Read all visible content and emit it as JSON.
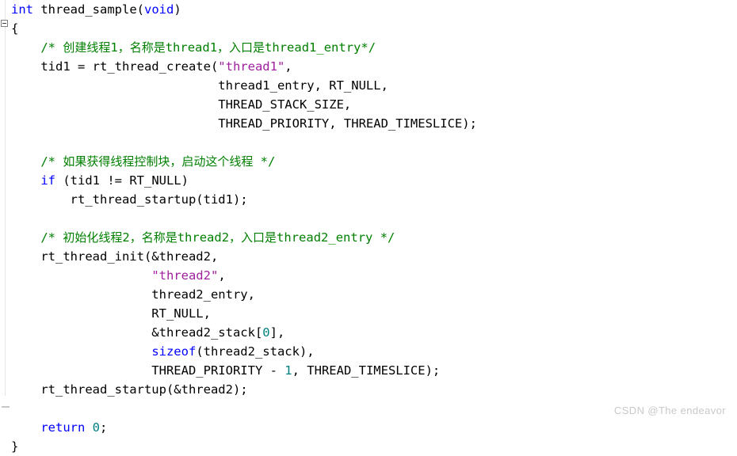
{
  "editor": {
    "background_color": "#ffffff",
    "gutter": {
      "fold_toggle_label": "-",
      "fold_toggle_name": "collapse-block-toggle"
    },
    "syntax_colors": {
      "keyword": "#0000ff",
      "comment": "#008000",
      "string": "#a020a0",
      "number": "#008080",
      "plain": "#000000"
    }
  },
  "code": {
    "language": "c",
    "lines": [
      {
        "n": 1,
        "segments": [
          {
            "t": "int",
            "c": "kw"
          },
          {
            "t": " thread_sample(",
            "c": "pln"
          },
          {
            "t": "void",
            "c": "kw"
          },
          {
            "t": ")",
            "c": "pln"
          }
        ]
      },
      {
        "n": 2,
        "segments": [
          {
            "t": "{",
            "c": "pln"
          }
        ]
      },
      {
        "n": 3,
        "segments": [
          {
            "t": "    /* 创建线程1，名称是thread1，入口是thread1_entry*/",
            "c": "cmt"
          }
        ]
      },
      {
        "n": 4,
        "segments": [
          {
            "t": "    tid1 = rt_thread_create(",
            "c": "pln"
          },
          {
            "t": "\"thread1\"",
            "c": "str"
          },
          {
            "t": ",",
            "c": "pln"
          }
        ]
      },
      {
        "n": 5,
        "segments": [
          {
            "t": "                            thread1_entry, RT_NULL,",
            "c": "pln"
          }
        ]
      },
      {
        "n": 6,
        "segments": [
          {
            "t": "                            THREAD_STACK_SIZE,",
            "c": "pln"
          }
        ]
      },
      {
        "n": 7,
        "segments": [
          {
            "t": "                            THREAD_PRIORITY, THREAD_TIMESLICE);",
            "c": "pln"
          }
        ]
      },
      {
        "n": 8,
        "segments": []
      },
      {
        "n": 9,
        "segments": [
          {
            "t": "    /* 如果获得线程控制块，启动这个线程 */",
            "c": "cmt"
          }
        ]
      },
      {
        "n": 10,
        "segments": [
          {
            "t": "    ",
            "c": "pln"
          },
          {
            "t": "if",
            "c": "kw"
          },
          {
            "t": " (tid1 != RT_NULL)",
            "c": "pln"
          }
        ]
      },
      {
        "n": 11,
        "segments": [
          {
            "t": "        rt_thread_startup(tid1);",
            "c": "pln"
          }
        ]
      },
      {
        "n": 12,
        "segments": []
      },
      {
        "n": 13,
        "segments": [
          {
            "t": "    /* 初始化线程2，名称是thread2，入口是thread2_entry */",
            "c": "cmt"
          }
        ]
      },
      {
        "n": 14,
        "segments": [
          {
            "t": "    rt_thread_init(&thread2,",
            "c": "pln"
          }
        ]
      },
      {
        "n": 15,
        "segments": [
          {
            "t": "                   ",
            "c": "pln"
          },
          {
            "t": "\"thread2\"",
            "c": "str"
          },
          {
            "t": ",",
            "c": "pln"
          }
        ]
      },
      {
        "n": 16,
        "segments": [
          {
            "t": "                   thread2_entry,",
            "c": "pln"
          }
        ]
      },
      {
        "n": 17,
        "segments": [
          {
            "t": "                   RT_NULL,",
            "c": "pln"
          }
        ]
      },
      {
        "n": 18,
        "segments": [
          {
            "t": "                   &thread2_stack[",
            "c": "pln"
          },
          {
            "t": "0",
            "c": "num"
          },
          {
            "t": "],",
            "c": "pln"
          }
        ]
      },
      {
        "n": 19,
        "segments": [
          {
            "t": "                   ",
            "c": "pln"
          },
          {
            "t": "sizeof",
            "c": "kw"
          },
          {
            "t": "(thread2_stack),",
            "c": "pln"
          }
        ]
      },
      {
        "n": 20,
        "segments": [
          {
            "t": "                   THREAD_PRIORITY - ",
            "c": "pln"
          },
          {
            "t": "1",
            "c": "num"
          },
          {
            "t": ", THREAD_TIMESLICE);",
            "c": "pln"
          }
        ]
      },
      {
        "n": 21,
        "segments": [
          {
            "t": "    rt_thread_startup(&thread2);",
            "c": "pln"
          }
        ]
      },
      {
        "n": 22,
        "segments": []
      },
      {
        "n": 23,
        "segments": [
          {
            "t": "    ",
            "c": "pln"
          },
          {
            "t": "return",
            "c": "kw"
          },
          {
            "t": " ",
            "c": "pln"
          },
          {
            "t": "0",
            "c": "num"
          },
          {
            "t": ";",
            "c": "pln"
          }
        ]
      },
      {
        "n": 24,
        "segments": [
          {
            "t": "}",
            "c": "pln"
          }
        ]
      }
    ]
  },
  "watermark": {
    "text": "CSDN @The endeavor",
    "color": "#c9c9c9"
  }
}
